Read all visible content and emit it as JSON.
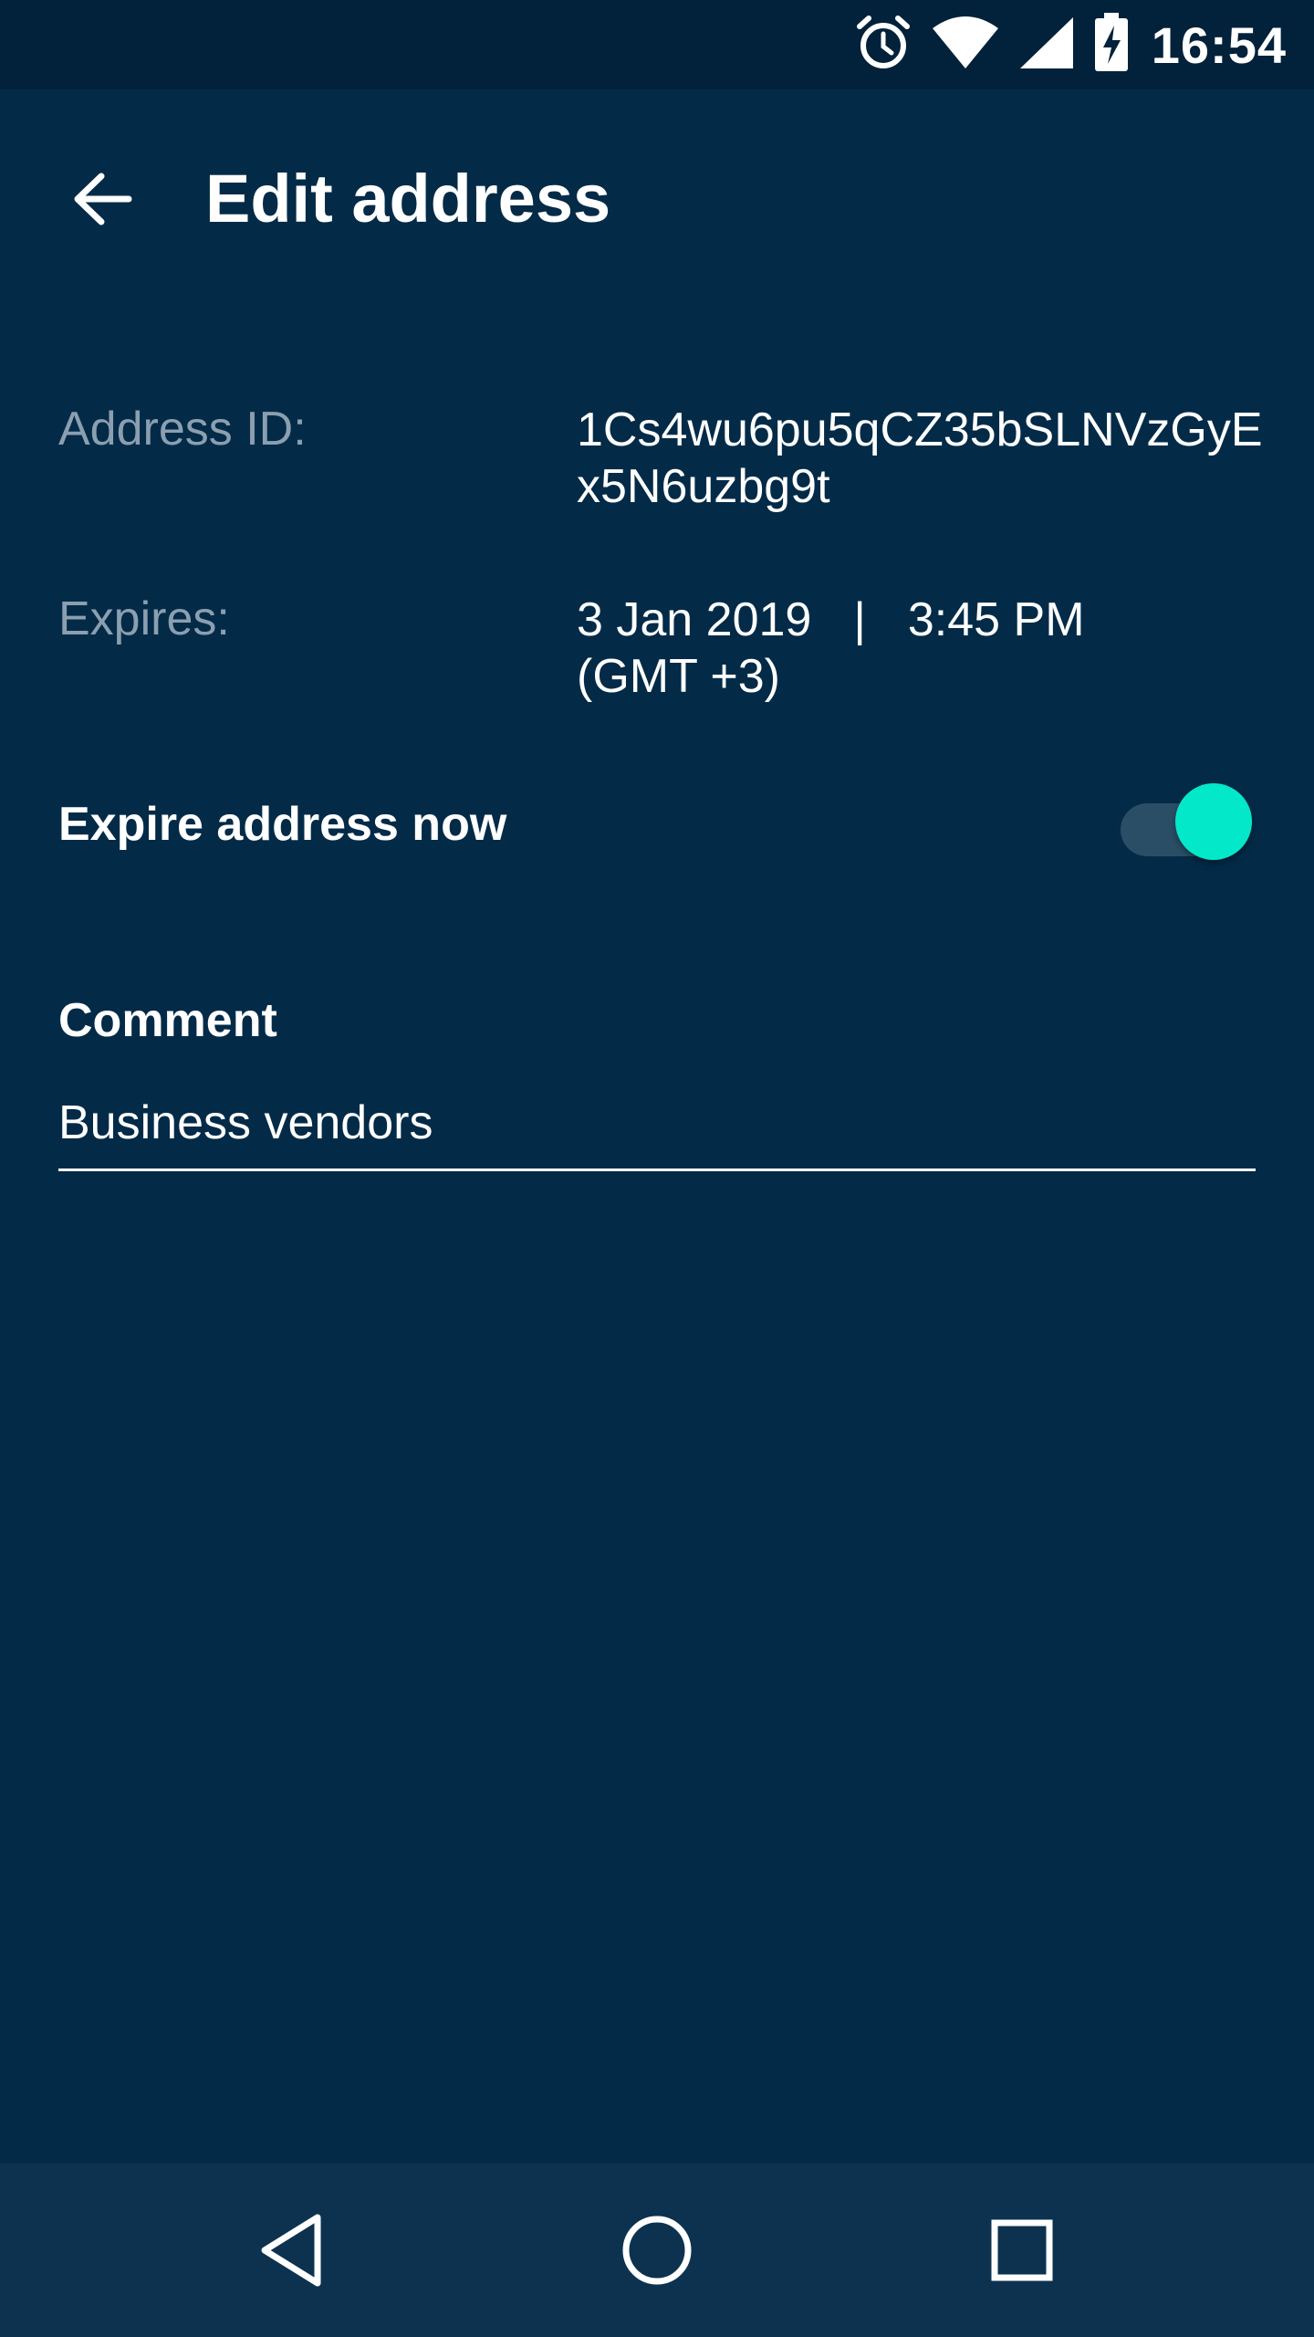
{
  "status_bar": {
    "time": "16:54",
    "icons": [
      "alarm-icon",
      "wifi-icon",
      "signal-icon",
      "battery-charging-icon"
    ]
  },
  "app_bar": {
    "back_icon": "arrow-back-icon",
    "title": "Edit address"
  },
  "details": {
    "address_id_label": "Address ID:",
    "address_id_value": "1Cs4wu6pu5qCZ35bSLNVzGyEx5N6uzbg9t",
    "expires_label": "Expires:",
    "expires_date": "3 Jan 2019",
    "expires_separator": "|",
    "expires_time": "3:45 PM",
    "expires_timezone": "(GMT +3)"
  },
  "expire_now": {
    "label": "Expire address now",
    "toggle_on": true
  },
  "comment": {
    "label": "Comment",
    "value": "Business vendors"
  },
  "navigation": {
    "buttons": [
      "nav-back-icon",
      "nav-home-icon",
      "nav-recent-icon"
    ]
  },
  "colors": {
    "background": "#032b48",
    "status_bar": "#02213a",
    "nav_bar": "#0c324f",
    "accent": "#03e8c9",
    "label_muted": "#8b9fb0"
  }
}
